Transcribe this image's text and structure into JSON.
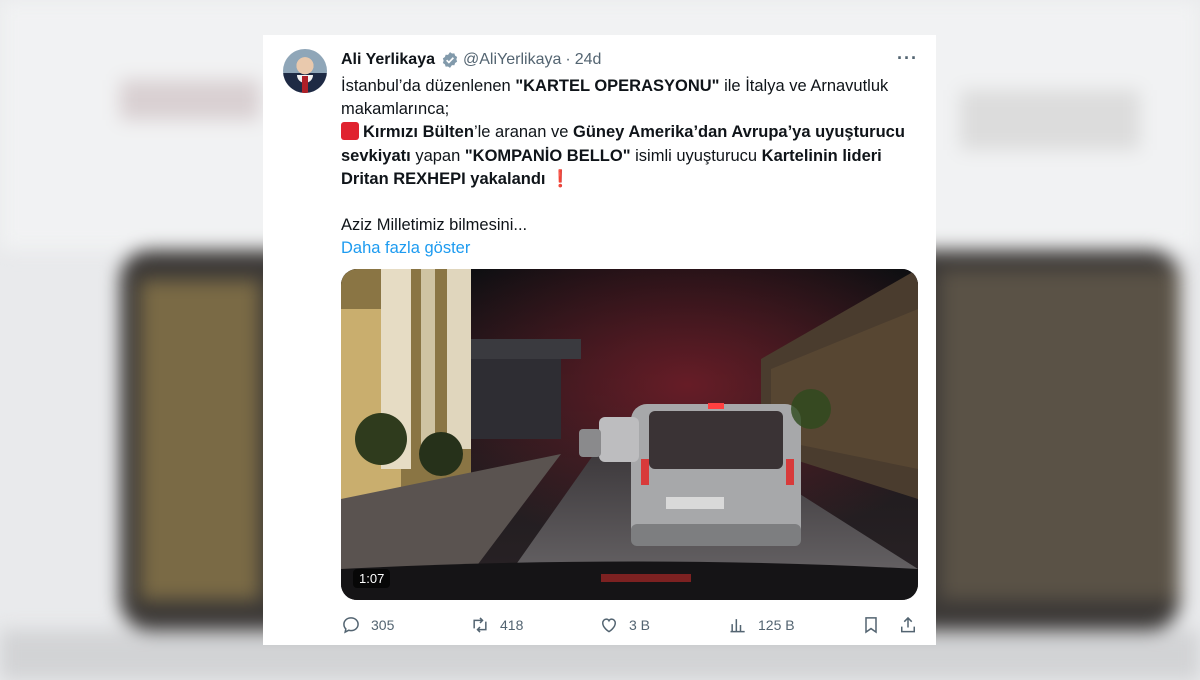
{
  "tweet": {
    "name": "Ali Yerlikaya",
    "handle": "@AliYerlikaya",
    "separator": "·",
    "time": "24d",
    "more": "···",
    "line1_a": "İstanbul’da düzenlenen ",
    "line1_b": "\"KARTEL OPERASYONU\"",
    "line1_c": " ile İtalya ve Arnavutluk makamlarınca;",
    "p2_a": "Kırmızı Bülten",
    "p2_b": "’le aranan ve ",
    "p2_c": "Güney Amerika’dan Avrupa’ya uyuşturucu sevkiyatı",
    "p2_d": " yapan ",
    "p2_e": "\"KOMPANİO BELLO\"",
    "p2_f": " isimli uyuşturucu ",
    "p2_g": "Kartelinin lideri Dritan REXHEPI yakalandı",
    "p2_excl": "❗",
    "p3": "Aziz Milletimiz bilmesini...",
    "show_more": "Daha fazla göster",
    "video_duration": "1:07"
  },
  "actions": {
    "replies": "305",
    "reposts": "418",
    "likes": "3 B",
    "views": "125 B"
  },
  "icons": [
    "verified-badge-icon",
    "more-icon",
    "reply-icon",
    "repost-icon",
    "like-icon",
    "views-icon",
    "bookmark-icon",
    "share-icon"
  ],
  "colors": {
    "accent": "#1d9bf0",
    "text": "#0f1419",
    "muted": "#536471",
    "alert": "#e0222f"
  }
}
